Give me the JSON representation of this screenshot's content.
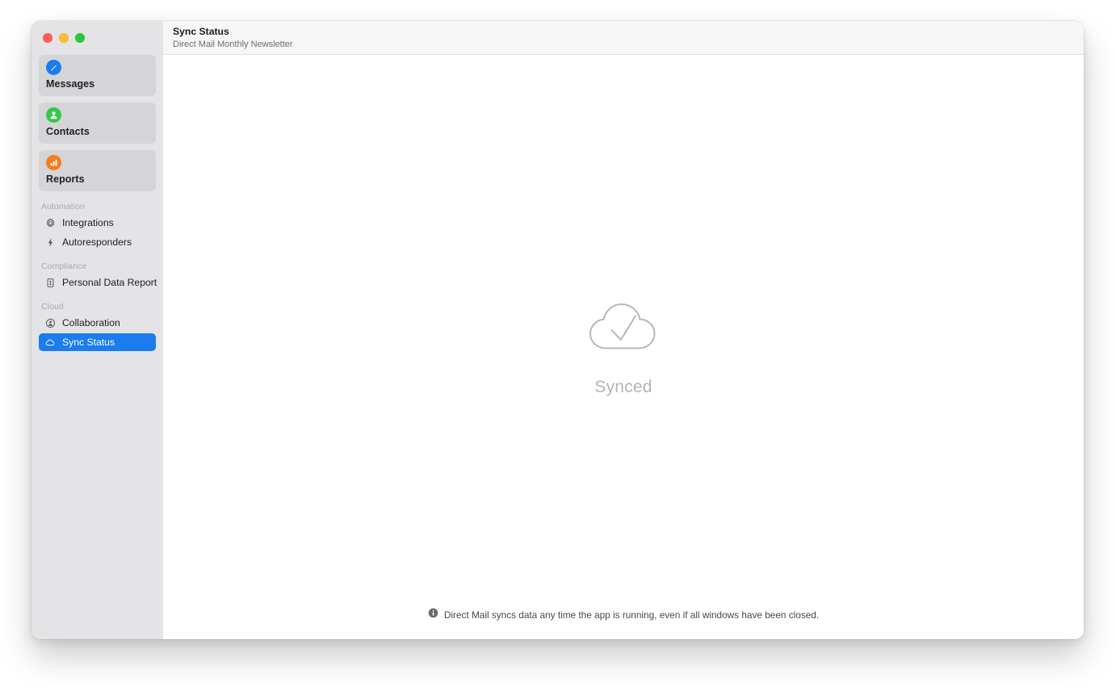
{
  "window": {
    "traffic_lights": [
      {
        "name": "close",
        "color": "#ff5f57"
      },
      {
        "name": "minimize",
        "color": "#febc2e"
      },
      {
        "name": "zoom",
        "color": "#28c840"
      }
    ]
  },
  "header": {
    "title": "Sync Status",
    "subtitle": "Direct Mail Monthly Newsletter"
  },
  "sidebar": {
    "cards": [
      {
        "label": "Messages",
        "icon": "compose-icon",
        "color": "#1a7ced"
      },
      {
        "label": "Contacts",
        "icon": "person-icon",
        "color": "#34c749"
      },
      {
        "label": "Reports",
        "icon": "chart-icon",
        "color": "#f57c1f"
      }
    ],
    "sections": [
      {
        "title": "Automation",
        "items": [
          {
            "label": "Integrations",
            "icon": "gear-icon",
            "selected": false
          },
          {
            "label": "Autoresponders",
            "icon": "lightning-icon",
            "selected": false
          }
        ]
      },
      {
        "title": "Compliance",
        "items": [
          {
            "label": "Personal Data Report",
            "icon": "document-icon",
            "selected": false
          }
        ]
      },
      {
        "title": "Cloud",
        "items": [
          {
            "label": "Collaboration",
            "icon": "person-circle-icon",
            "selected": false
          },
          {
            "label": "Sync Status",
            "icon": "cloud-icon",
            "selected": true
          }
        ]
      }
    ],
    "accent_color": "#1a7ced"
  },
  "main": {
    "status_icon": "cloud-check-icon",
    "status_label": "Synced",
    "status_color": "#b4b4b6"
  },
  "footer": {
    "icon": "info-icon",
    "text": "Direct Mail syncs data any time the app is running, even if all windows have been closed."
  }
}
